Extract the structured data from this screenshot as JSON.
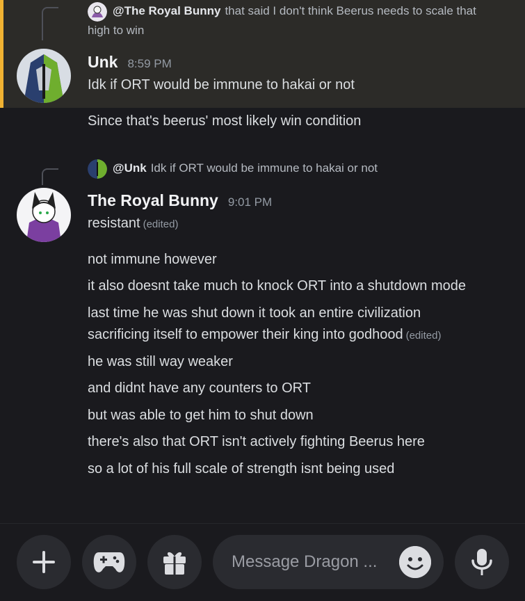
{
  "message1": {
    "reply_to": "@The Royal Bunny",
    "reply_text_line1": "that said I don't think Beerus needs to scale that",
    "reply_text_line2": "high to win",
    "author": "Unk",
    "time": "8:59 PM",
    "lines": [
      "Idk if ORT would be immune to hakai or not",
      "Since that's beerus' most likely win condition"
    ]
  },
  "message2": {
    "reply_to": "@Unk",
    "reply_text": "Idk if ORT would be immune to hakai or not",
    "author": "The Royal Bunny",
    "time": "9:01 PM",
    "first_line": "resistant",
    "edited_label": "(edited)",
    "lines": [
      "not immune however",
      "it also doesnt take much to knock ORT into a shutdown mode",
      "last time he was shut down it took an entire civilization",
      "sacrificing itself to empower their king into godhood",
      "he was still way weaker",
      "and didnt have any counters to ORT",
      "but was able to get him to shut down",
      "there's also that ORT isn't actively fighting Beerus here",
      "so a lot of his full scale of strength isnt being used"
    ]
  },
  "composer": {
    "placeholder": "Message Dragon ..."
  },
  "colors": {
    "highlight_bar": "#f0b232",
    "highlight_bg": "#2c2b28",
    "background": "#1a1a1e"
  }
}
